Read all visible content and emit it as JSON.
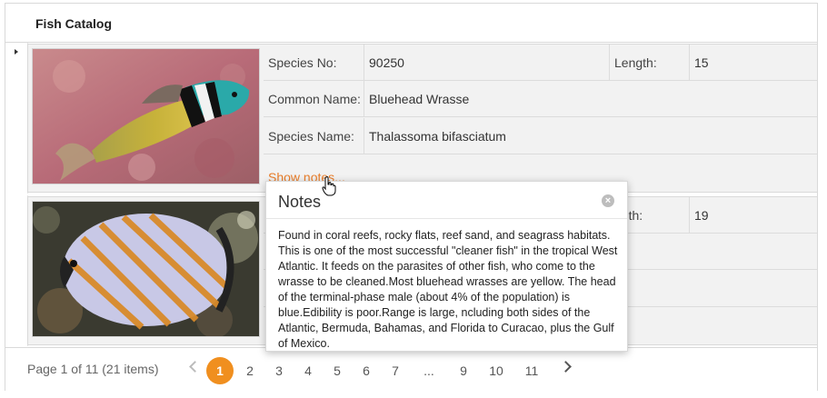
{
  "grid": {
    "title": "Fish Catalog"
  },
  "labels": {
    "species_no": "Species No:",
    "length": "Length:",
    "common_name": "Common Name:",
    "species_name": "Species Name:",
    "show_notes": "Show notes..."
  },
  "records": [
    {
      "species_no": "90250",
      "length": "15",
      "common_name": "Bluehead Wrasse",
      "species_name": "Thalassoma bifasciatum"
    },
    {
      "length_label_partial": "ngth:",
      "length": "19"
    }
  ],
  "popup": {
    "title": "Notes",
    "close_icon": "×",
    "body": "Found in coral reefs, rocky flats, reef sand, and seagrass habitats. This is one of the most successful \"cleaner fish\" in the tropical West Atlantic. It feeds on the parasites of other fish, who come to the wrasse to be cleaned.Most bluehead wrasses are yellow. The head of the terminal-phase male (about 4% of the population) is blue.Edibility is poor.Range is large, ncluding both sides of the Atlantic, Bermuda, Bahamas, and Florida to Curacao, plus the Gulf of Mexico."
  },
  "pager": {
    "info": "Page 1 of 11 (21 items)",
    "pages": [
      "1",
      "2",
      "3",
      "4",
      "5",
      "6",
      "7",
      "...",
      "9",
      "10",
      "11"
    ],
    "active_page": "1"
  },
  "colors": {
    "accent": "#f08f1f",
    "link": "#e87d2a",
    "detail_bg": "#f2f2f2",
    "border": "#d9d9d9"
  }
}
